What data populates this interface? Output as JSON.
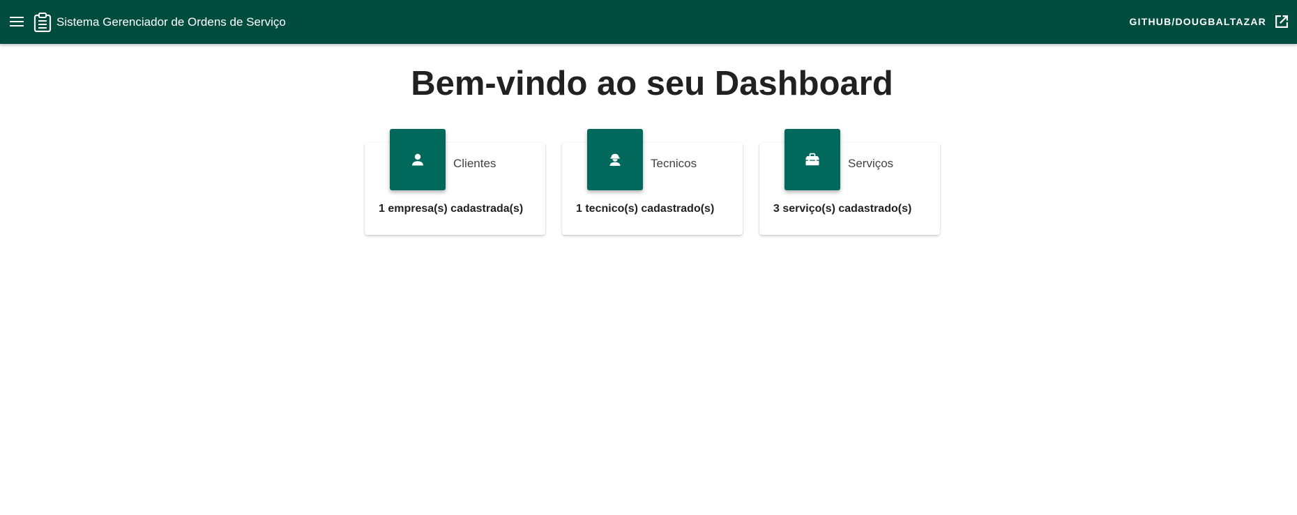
{
  "header": {
    "title": "Sistema Gerenciador de Ordens de Serviço",
    "github_label": "GITHUB/DOUGBALTAZAR",
    "background_color": "#004d40",
    "icons": [
      "menu-icon",
      "clipboard-icon",
      "open-in-new-icon"
    ]
  },
  "main": {
    "title": "Bem-vindo ao seu Dashboard",
    "cards": [
      {
        "label": "Clientes",
        "count_text": "1 empresa(s) cadastrada(s)",
        "icon": "account-icon",
        "badge_color": "#00695c"
      },
      {
        "label": "Tecnicos",
        "count_text": "1 tecnico(s) cadastrado(s)",
        "icon": "worker-helmet-icon",
        "badge_color": "#00695c"
      },
      {
        "label": "Serviços",
        "count_text": "3 serviço(s) cadastrado(s)",
        "icon": "toolbox-icon",
        "badge_color": "#00695c"
      }
    ]
  }
}
